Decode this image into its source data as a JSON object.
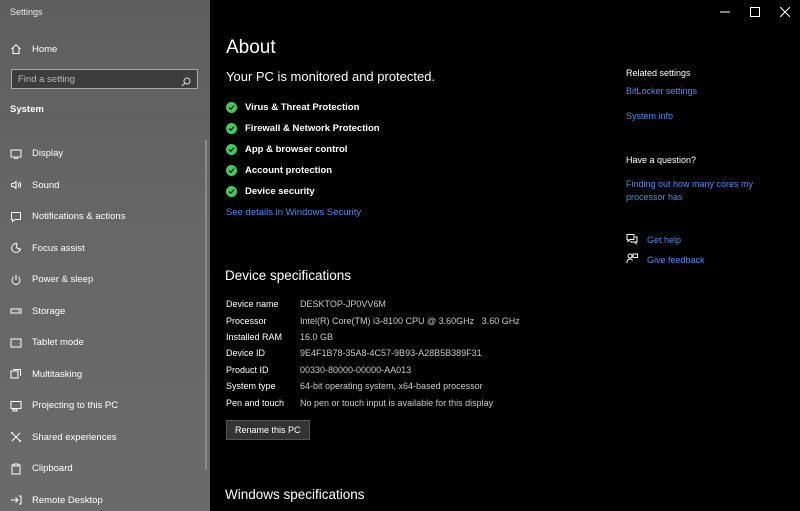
{
  "window": {
    "title": "Settings"
  },
  "sidebar": {
    "home_label": "Home",
    "search_placeholder": "Find a setting",
    "section_label": "System",
    "items": [
      {
        "label": "Display",
        "icon": "display-icon"
      },
      {
        "label": "Sound",
        "icon": "sound-icon"
      },
      {
        "label": "Notifications & actions",
        "icon": "notifications-icon"
      },
      {
        "label": "Focus assist",
        "icon": "focus-assist-icon"
      },
      {
        "label": "Power & sleep",
        "icon": "power-icon"
      },
      {
        "label": "Storage",
        "icon": "storage-icon"
      },
      {
        "label": "Tablet mode",
        "icon": "tablet-icon"
      },
      {
        "label": "Multitasking",
        "icon": "multitasking-icon"
      },
      {
        "label": "Projecting to this PC",
        "icon": "projecting-icon"
      },
      {
        "label": "Shared experiences",
        "icon": "shared-experiences-icon"
      },
      {
        "label": "Clipboard",
        "icon": "clipboard-icon"
      },
      {
        "label": "Remote Desktop",
        "icon": "remote-desktop-icon"
      }
    ]
  },
  "main": {
    "title": "About",
    "protected_text": "Your PC is monitored and protected.",
    "protections": [
      "Virus & Threat Protection",
      "Firewall & Network Protection",
      "App & browser control",
      "Account protection",
      "Device security"
    ],
    "see_details_link": "See details in Windows Security",
    "device_specs_title": "Device specifications",
    "device_specs": [
      {
        "key": "Device name",
        "value": "DESKTOP-JP0VV6M"
      },
      {
        "key": "Processor",
        "value": "Intel(R) Core(TM) i3-8100 CPU @ 3.60GHz   3.60 GHz"
      },
      {
        "key": "Installed RAM",
        "value": "16.0 GB"
      },
      {
        "key": "Device ID",
        "value": "9E4F1B78-35A8-4C57-9B93-A28B5B389F31"
      },
      {
        "key": "Product ID",
        "value": "00330-80000-00000-AA013"
      },
      {
        "key": "System type",
        "value": "64-bit operating system, x64-based processor"
      },
      {
        "key": "Pen and touch",
        "value": "No pen or touch input is available for this display"
      }
    ],
    "rename_button": "Rename this PC",
    "windows_specs_title": "Windows specifications"
  },
  "rail": {
    "related_title": "Related settings",
    "related_links": [
      "BitLocker settings",
      "System info"
    ],
    "question_title": "Have a question?",
    "question_link": "Finding out how many cores my processor has",
    "get_help": "Get help",
    "give_feedback": "Give feedback"
  },
  "colors": {
    "accent_link": "#4c8cf5",
    "check_green": "#3ccd5c",
    "sidebar_bg": "#646464",
    "main_bg": "#000000"
  }
}
